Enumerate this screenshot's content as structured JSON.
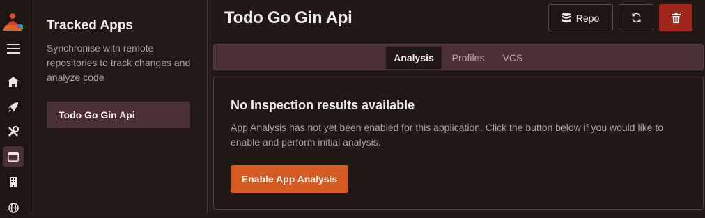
{
  "sidebar": {
    "nav": [
      {
        "icon": "menu-icon"
      },
      {
        "icon": "home-icon"
      },
      {
        "icon": "rocket-icon"
      },
      {
        "icon": "tools-icon"
      },
      {
        "icon": "window-icon",
        "active": true
      },
      {
        "icon": "building-icon"
      },
      {
        "icon": "globe-icon"
      }
    ]
  },
  "apps_panel": {
    "title": "Tracked Apps",
    "description": "Synchronise with remote repositories to track changes and analyze code",
    "items": [
      {
        "label": "Todo Go Gin Api",
        "selected": true
      }
    ]
  },
  "header": {
    "title": "Todo Go Gin Api",
    "repo_label": "Repo",
    "icons": {
      "repo": "database-icon",
      "refresh": "refresh-icon",
      "delete": "trash-icon"
    }
  },
  "tabs": [
    {
      "label": "Analysis",
      "active": true
    },
    {
      "label": "Profiles",
      "active": false
    },
    {
      "label": "VCS",
      "active": false
    }
  ],
  "card": {
    "title": "No Inspection results available",
    "body": "App Analysis has not yet been enabled for this application. Click the button below if you would like to enable and perform initial analysis.",
    "button_label": "Enable App Analysis"
  },
  "colors": {
    "accent": "#d55b22",
    "danger": "#a0271b",
    "selected": "#4a2f33",
    "background": "#211916"
  }
}
